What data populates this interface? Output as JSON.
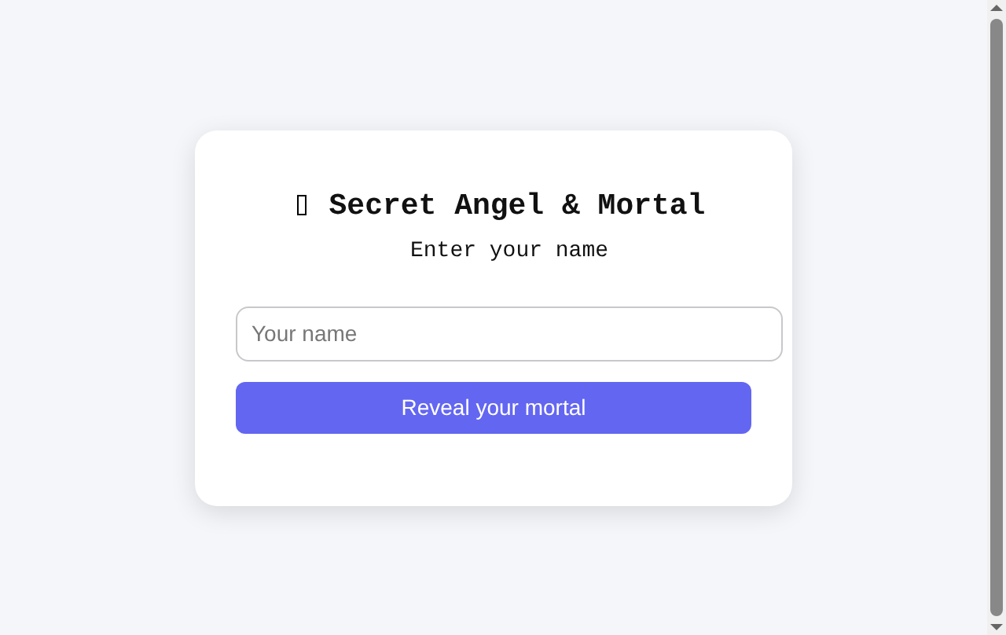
{
  "card": {
    "title": "Secret Angel & Mortal",
    "subtitle": "Enter your name"
  },
  "name_field": {
    "placeholder": "Your name"
  },
  "button": {
    "label": "Reveal your mortal"
  }
}
